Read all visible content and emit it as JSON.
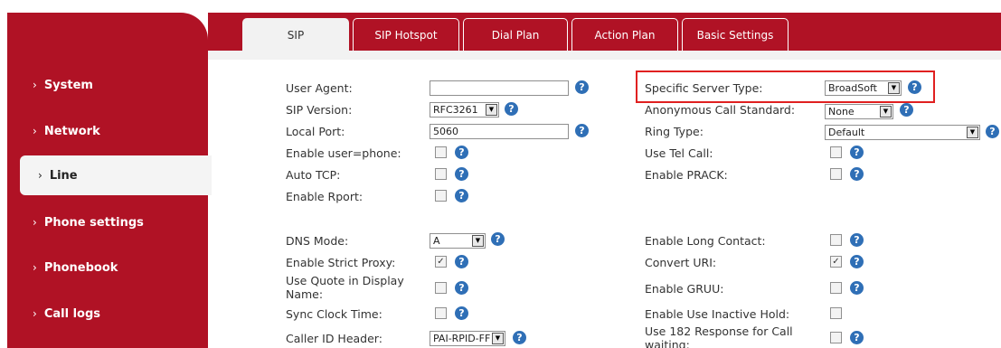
{
  "sidebar": {
    "items": [
      {
        "label": "System"
      },
      {
        "label": "Network"
      },
      {
        "label": "Line"
      },
      {
        "label": "Phone settings"
      },
      {
        "label": "Phonebook"
      },
      {
        "label": "Call logs"
      }
    ]
  },
  "tabs": [
    {
      "label": "SIP"
    },
    {
      "label": "SIP Hotspot"
    },
    {
      "label": "Dial Plan"
    },
    {
      "label": "Action Plan"
    },
    {
      "label": "Basic Settings"
    }
  ],
  "form": {
    "user_agent": {
      "label": "User Agent:",
      "value": ""
    },
    "sip_version": {
      "label": "SIP Version:",
      "value": "RFC3261"
    },
    "local_port": {
      "label": "Local Port:",
      "value": "5060"
    },
    "enable_user_phone": {
      "label": "Enable user=phone:",
      "checked": false
    },
    "auto_tcp": {
      "label": "Auto TCP:",
      "checked": false
    },
    "enable_rport": {
      "label": "Enable Rport:",
      "checked": false
    },
    "dns_mode": {
      "label": "DNS Mode:",
      "value": "A"
    },
    "enable_strict_proxy": {
      "label": "Enable Strict Proxy:",
      "checked": true
    },
    "use_quote": {
      "label_line1": "Use Quote in Display",
      "label_line2": "Name:",
      "checked": false
    },
    "sync_clock": {
      "label": "Sync Clock Time:",
      "checked": false
    },
    "caller_id_header": {
      "label": "Caller ID Header:",
      "value": "PAI-RPID-FF"
    },
    "specific_server_type": {
      "label": "Specific Server Type:",
      "value": "BroadSoft"
    },
    "anonymous_call_standard": {
      "label": "Anonymous Call Standard:",
      "value": "None"
    },
    "ring_type": {
      "label": "Ring Type:",
      "value": "Default"
    },
    "use_tel_call": {
      "label": "Use Tel Call:",
      "checked": false
    },
    "enable_prack": {
      "label": "Enable PRACK:",
      "checked": false
    },
    "enable_long_contact": {
      "label": "Enable Long Contact:",
      "checked": false
    },
    "convert_uri": {
      "label": "Convert URI:",
      "checked": true
    },
    "enable_gruu": {
      "label": "Enable GRUU:",
      "checked": false
    },
    "enable_inactive_hold": {
      "label": "Enable Use Inactive Hold:",
      "checked": false
    },
    "use_182": {
      "label_line1": "Use 182 Response for Call",
      "label_line2": "waiting:",
      "checked": false
    }
  },
  "icons": {
    "help": "?",
    "dropdown": "▼",
    "check": "✓",
    "chevron": "›"
  },
  "colors": {
    "brand_red": "#b01225",
    "help_blue": "#2f6fb6",
    "highlight_red": "#e02020"
  }
}
